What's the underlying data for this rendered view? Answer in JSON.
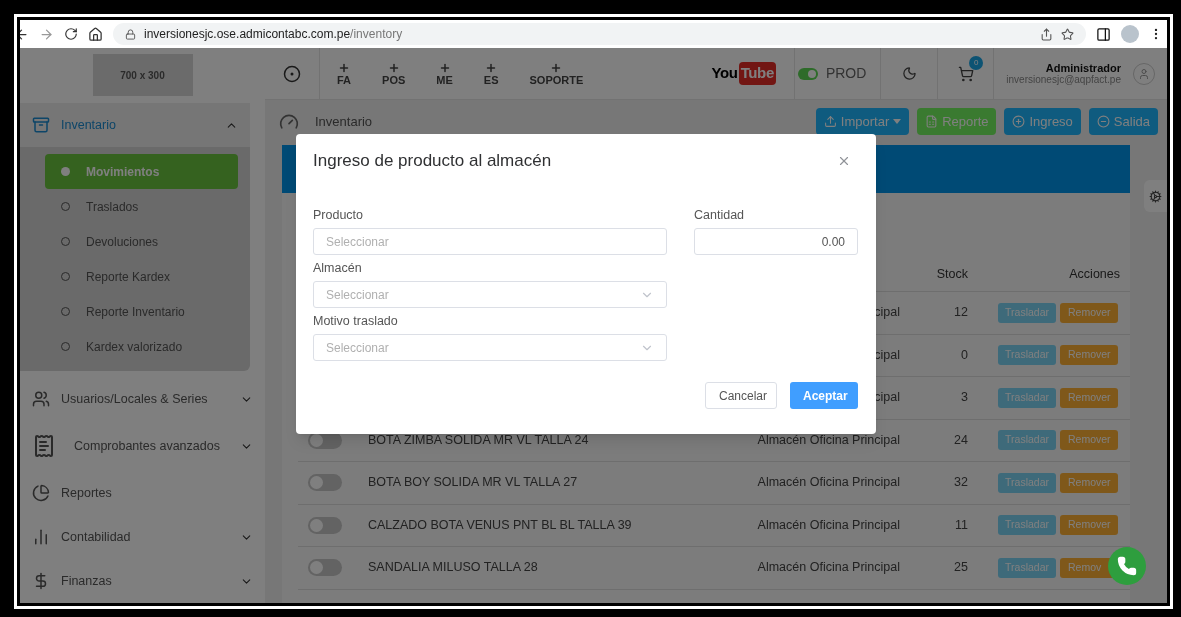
{
  "browser": {
    "url_host": "inversionesjc.ose.admicontabc.com.pe",
    "url_path": "/inventory"
  },
  "sidebar": {
    "logo_placeholder": "700 x 300",
    "items": [
      {
        "label": "Inventario",
        "expanded": true,
        "children": [
          {
            "label": "Movimientos",
            "selected": true
          },
          {
            "label": "Traslados",
            "selected": false
          },
          {
            "label": "Devoluciones",
            "selected": false
          },
          {
            "label": "Reporte Kardex",
            "selected": false
          },
          {
            "label": "Reporte Inventario",
            "selected": false
          },
          {
            "label": "Kardex valorizado",
            "selected": false
          }
        ]
      },
      {
        "label": "Usuarios/Locales & Series",
        "expanded": false
      },
      {
        "label": "Comprobantes avanzados",
        "expanded": false
      },
      {
        "label": "Reportes"
      },
      {
        "label": "Contabilidad",
        "expanded": false
      },
      {
        "label": "Finanzas",
        "expanded": false
      }
    ]
  },
  "header": {
    "shortcuts": [
      "FA",
      "POS",
      "ME",
      "ES",
      "SOPORTE"
    ],
    "youtube": {
      "left": "You",
      "right": "Tube"
    },
    "environment": {
      "label": "PROD",
      "on": true
    },
    "cart_count": "0",
    "user": {
      "name": "Administrador",
      "email": "inversionesjc@aqpfact.pe"
    }
  },
  "breadcrumb": "Inventario",
  "toolbar": [
    {
      "label": "Importar",
      "kind": "dropdown"
    },
    {
      "label": "Reporte",
      "kind": "report"
    },
    {
      "label": "Ingreso",
      "kind": "add"
    },
    {
      "label": "Salida",
      "kind": "remove"
    }
  ],
  "table": {
    "columns": [
      "Stock",
      "Acciones"
    ],
    "rows": [
      {
        "warehouse": "cipal",
        "stock": "12",
        "actions": [
          "Trasladar",
          "Remover"
        ]
      },
      {
        "warehouse": "cipal",
        "stock": "0",
        "actions": [
          "Trasladar",
          "Remover"
        ]
      },
      {
        "warehouse": "cipal",
        "stock": "3",
        "actions": [
          "Trasladar",
          "Remover"
        ]
      },
      {
        "active": false,
        "product": "BOTA ZIMBA SOLIDA MR VL TALLA 24",
        "warehouse": "Almacén Oficina Principal",
        "stock": "24",
        "actions": [
          "Trasladar",
          "Remover"
        ]
      },
      {
        "active": false,
        "product": "BOTA BOY SOLIDA MR VL TALLA 27",
        "warehouse": "Almacén Oficina Principal",
        "stock": "32",
        "actions": [
          "Trasladar",
          "Remover"
        ]
      },
      {
        "active": false,
        "product": "CALZADO BOTA VENUS PNT BL BL TALLA 39",
        "warehouse": "Almacén Oficina Principal",
        "stock": "11",
        "actions": [
          "Trasladar",
          "Remover"
        ]
      },
      {
        "active": false,
        "product": "SANDALIA MILUSO TALLA 28",
        "warehouse": "Almacén Oficina Principal",
        "stock": "25",
        "actions": [
          "Trasladar",
          "Remov"
        ]
      }
    ]
  },
  "modal": {
    "title": "Ingreso de producto al almacén",
    "left_fields": [
      {
        "label": "Producto",
        "placeholder": "Seleccionar",
        "kind": "text"
      },
      {
        "label": "Almacén",
        "placeholder": "Seleccionar",
        "kind": "select"
      },
      {
        "label": "Motivo traslado",
        "placeholder": "Seleccionar",
        "kind": "select"
      }
    ],
    "right_fields": [
      {
        "label": "Cantidad",
        "value": "0.00",
        "kind": "number"
      }
    ],
    "buttons": [
      {
        "label": "Cancelar",
        "kind": "secondary"
      },
      {
        "label": "Aceptar",
        "kind": "primary"
      }
    ]
  }
}
